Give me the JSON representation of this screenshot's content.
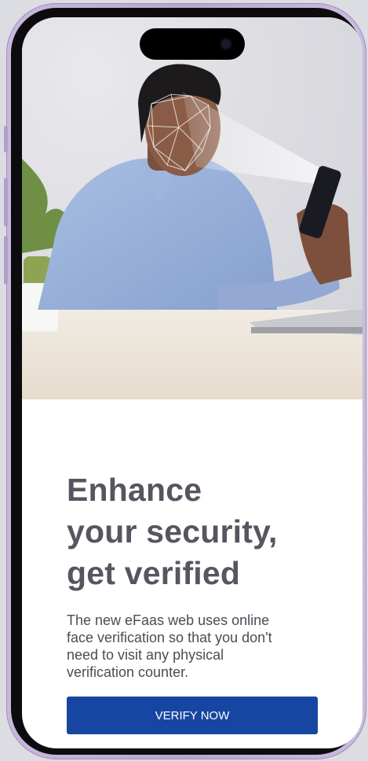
{
  "hero": {
    "image_subject": "person-face-scan-photo"
  },
  "headline": {
    "lines": [
      "Enhance",
      "your security,",
      "get verified"
    ]
  },
  "description": {
    "lines": [
      "The new eFaas web uses online",
      "face verification so that you don't",
      "need to visit any physical",
      "verification counter."
    ]
  },
  "actions": {
    "verify_label": "VERIFY NOW"
  },
  "colors": {
    "primary_button": "#1746a2",
    "headline_text": "#55565f",
    "body_text": "#4b4c55",
    "phone_frame": "#c9b8dc"
  }
}
